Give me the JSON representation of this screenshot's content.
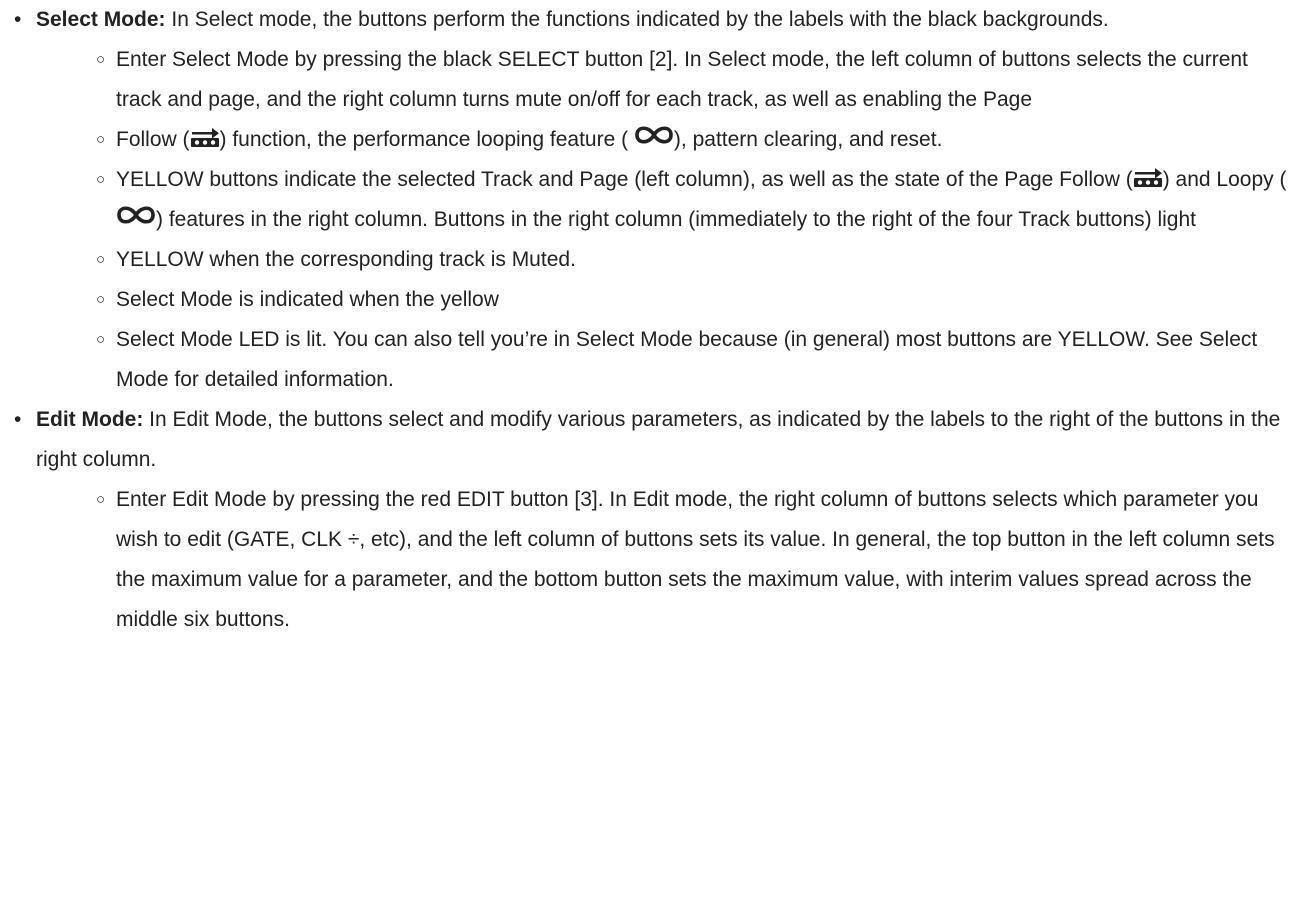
{
  "icons": {
    "follow": "page-follow-icon",
    "loop": "infinity-loop-icon"
  },
  "items": [
    {
      "lead": "Select Mode:",
      "text": " In Select mode, the buttons perform the functions indicated by the labels with the black backgrounds.",
      "sub": {
        "s0": "Enter Select Mode by pressing the black SELECT button [2]. In Select mode, the left column of buttons selects the current track and page, and the right column turns mute on/off for each track, as well as enabling the Page",
        "s1_a": "Follow (",
        "s1_b": ") function, the performance looping feature ( ",
        "s1_c": "), pattern clearing, and reset.",
        "s2_a": "YELLOW buttons indicate the selected Track and Page (left column), as well as the state of the Page Follow (",
        "s2_b": ") and Loopy (",
        "s2_c": ") features in the right column. Buttons in the right column (immediately to the right of the four Track buttons) light",
        "s3": "YELLOW when the corresponding track is Muted.",
        "s4": "Select Mode is indicated when the yellow",
        "s5": "Select Mode LED is lit. You can also tell you’re in Select Mode because (in general) most buttons are YELLOW. See Select Mode for detailed information."
      }
    },
    {
      "lead": "Edit Mode:",
      "text": " In Edit Mode, the buttons select and modify various parameters, as indicated by the labels to the right of the buttons in the right column.",
      "sub": {
        "s0": "Enter Edit Mode by pressing the red EDIT button [3]. In Edit mode, the right column of buttons selects which parameter you wish to edit (GATE, CLK ÷, etc), and the left column of buttons sets its value. In general, the top button in the left column sets the maximum value for a parameter, and the bottom button sets the maximum value, with interim values spread across the middle six buttons."
      }
    }
  ]
}
